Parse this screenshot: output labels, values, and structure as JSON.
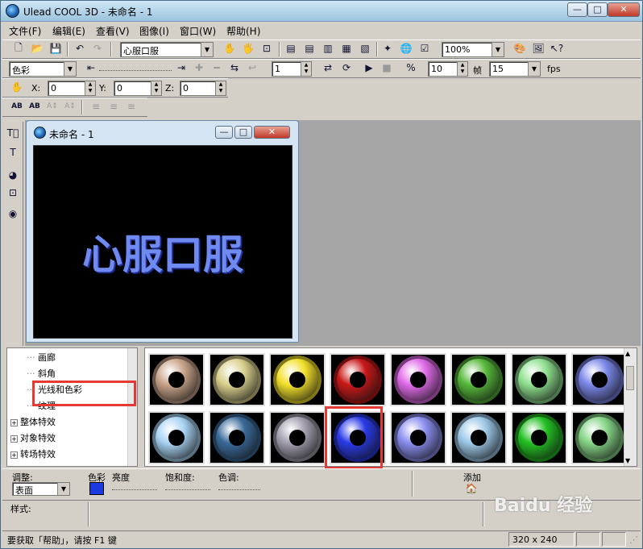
{
  "app": {
    "title": "Ulead COOL 3D - 未命名 - 1"
  },
  "window_controls": {
    "minimize": "—",
    "maximize": "□",
    "close": "✕"
  },
  "menu": [
    "文件(F)",
    "编辑(E)",
    "查看(V)",
    "图像(I)",
    "窗口(W)",
    "帮助(H)"
  ],
  "toolbar1": {
    "object_select": "心服口服",
    "zoom": "100%"
  },
  "toolbar2": {
    "attribute": "色彩",
    "frame": "1",
    "speed": "10",
    "frame_label": "帧",
    "fps_value": "15",
    "fps_label": "fps"
  },
  "toolbar3": {
    "x_label": "X:",
    "x_value": "0",
    "y_label": "Y:",
    "y_value": "0",
    "z_label": "Z:",
    "z_value": "0"
  },
  "document": {
    "title": "未命名 - 1",
    "text": "心服口服",
    "text_color": "#6f8af0"
  },
  "tree": {
    "items": [
      {
        "label": "画廊",
        "expandable": false
      },
      {
        "label": "斜角",
        "expandable": false
      },
      {
        "label": "光线和色彩",
        "expandable": false,
        "selected": true
      },
      {
        "label": "纹理",
        "expandable": false
      },
      {
        "label": "整体特效",
        "expandable": true
      },
      {
        "label": "对象特效",
        "expandable": true
      },
      {
        "label": "转场特效",
        "expandable": true
      }
    ]
  },
  "gallery": {
    "thumbnails": [
      {
        "color": "#c9a48a"
      },
      {
        "color": "#d9cf8c"
      },
      {
        "color": "#f2e02a"
      },
      {
        "color": "#c81818"
      },
      {
        "color": "#e06ae8"
      },
      {
        "color": "#56b83a"
      },
      {
        "color": "#8ee08e"
      },
      {
        "color": "#7a86e8"
      },
      {
        "color": "#a8d4f4"
      },
      {
        "color": "#3a6a9a"
      },
      {
        "color": "#a4a0b0"
      },
      {
        "color": "#2a3ae8",
        "selected": true
      },
      {
        "color": "#8a8ef0"
      },
      {
        "color": "#9cc8e8"
      },
      {
        "color": "#22c022"
      },
      {
        "color": "#86d486"
      }
    ]
  },
  "properties": {
    "adjust_label": "调整:",
    "adjust_value": "表面",
    "color_label": "色彩",
    "color_value": "#1a3ae0",
    "brightness_label": "亮度",
    "saturation_label": "饱和度:",
    "hue_label": "色调:",
    "add_label": "添加"
  },
  "style": {
    "label": "样式:"
  },
  "status": {
    "help": "要获取「帮助」，请按 F1 键",
    "size": "320 x 240"
  },
  "watermark": "Baidu 经验"
}
